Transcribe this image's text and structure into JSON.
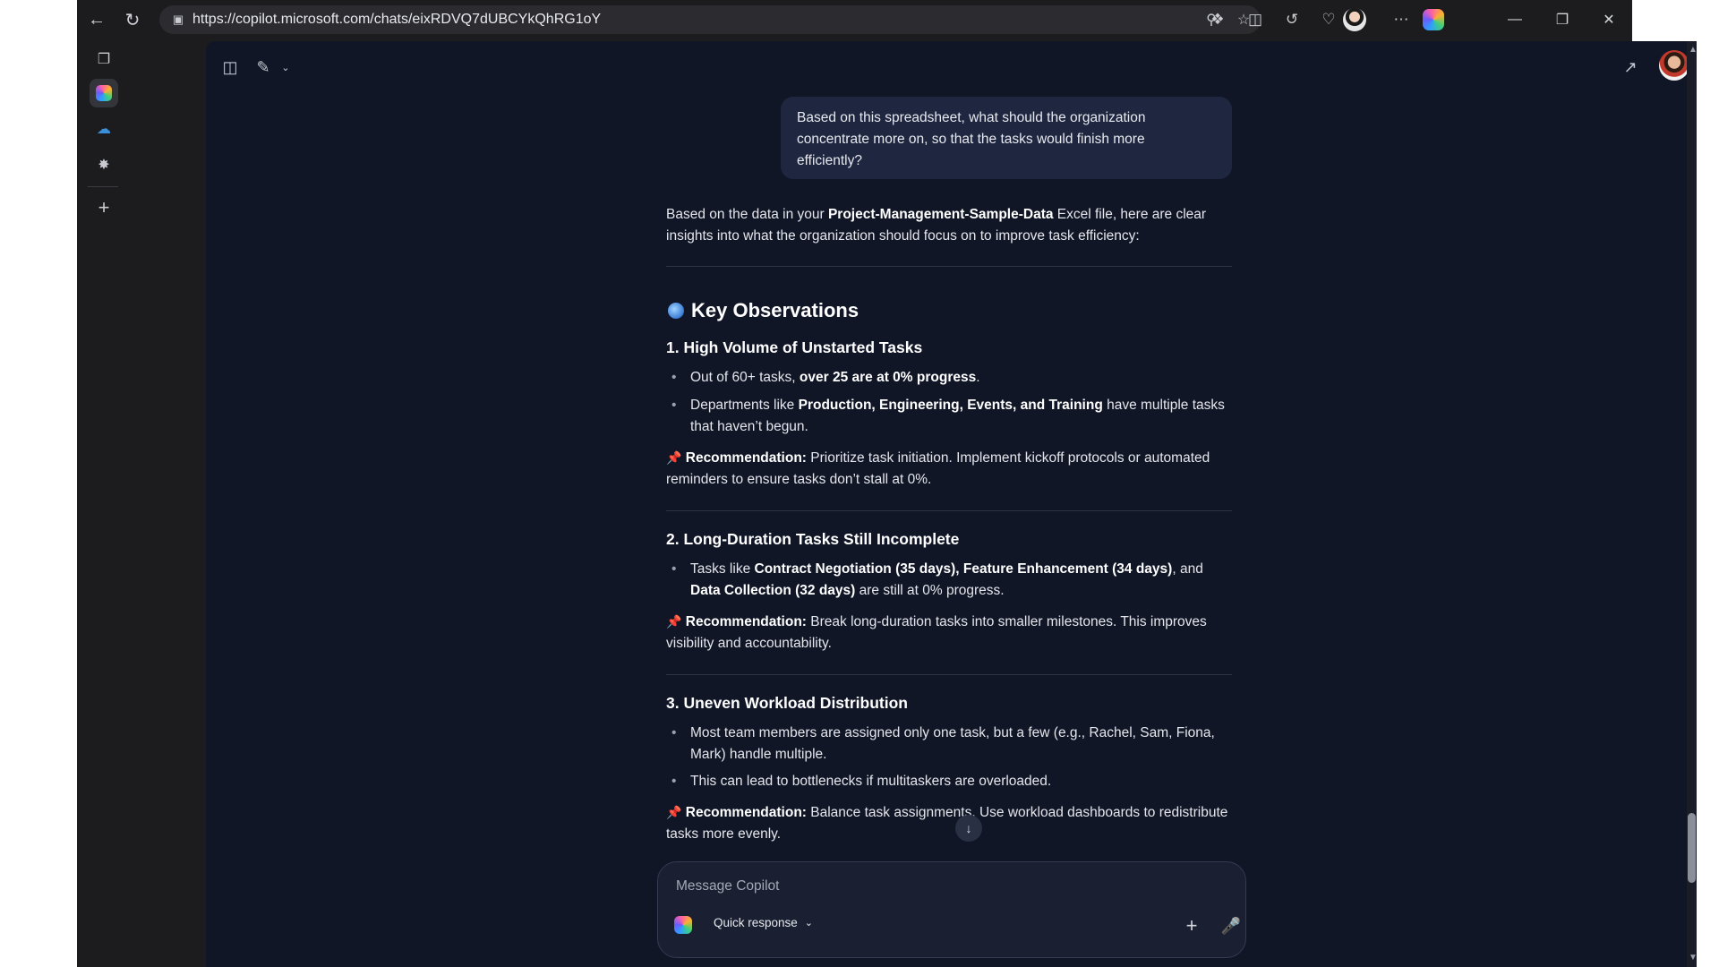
{
  "browser": {
    "url": "https://copilot.microsoft.com/chats/eixRDVQ7dUBCYkQhRG1oY"
  },
  "chat": {
    "user_message": "Based on this spreadsheet, what should the organization concentrate more on, so that the tasks would finish more efficiently?",
    "intro_pre": "Based on the data in your ",
    "intro_file": "Project-Management-Sample-Data",
    "intro_post": " Excel file, here are clear insights into what the organization should focus on to improve task efficiency:",
    "section_title": "Key Observations",
    "observations": [
      {
        "title": "1. High Volume of Unstarted Tasks",
        "b1_pre": "Out of 60+ tasks, ",
        "b1_bold": "over 25 are at 0% progress",
        "b1_post": ".",
        "b2_pre": "Departments like ",
        "b2_bold": "Production, Engineering, Events, and Training",
        "b2_post": " have multiple tasks that haven’t begun.",
        "reco_label": "Recommendation:",
        "reco_text": " Prioritize task initiation. Implement kickoff protocols or automated reminders to ensure tasks don’t stall at 0%."
      },
      {
        "title": "2. Long-Duration Tasks Still Incomplete",
        "b1_pre": "Tasks like ",
        "b1_bold1": "Contract Negotiation (35 days), Feature Enhancement (34 days)",
        "b1_mid": ", and ",
        "b1_bold2": "Data Collection (32 days)",
        "b1_post": " are still at 0% progress.",
        "reco_label": "Recommendation:",
        "reco_text": " Break long-duration tasks into smaller milestones. This improves visibility and accountability."
      },
      {
        "title": "3. Uneven Workload Distribution",
        "b1": "Most team members are assigned only one task, but a few (e.g., Rachel, Sam, Fiona, Mark) handle multiple.",
        "b2": "This can lead to bottlenecks if multitaskers are overloaded.",
        "reco_label": "Recommendation:",
        "reco_text": " Balance task assignments. Use workload dashboards to redistribute tasks more evenly."
      }
    ]
  },
  "composer": {
    "placeholder": "Message Copilot",
    "mode_label": "Quick response"
  }
}
